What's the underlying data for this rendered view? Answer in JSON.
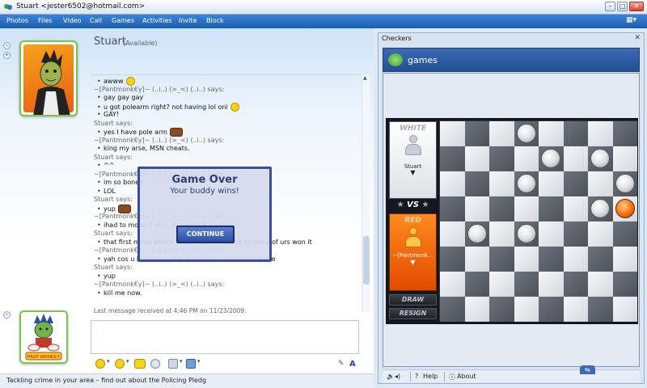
{
  "window": {
    "title": "Stuart <jester6502@hotmail.com>"
  },
  "menu": {
    "items": [
      "Photos",
      "Files",
      "Video",
      "Call",
      "Games",
      "Activities",
      "Invite",
      "Block"
    ]
  },
  "contact": {
    "name": "Stuart",
    "status": "(Available)"
  },
  "conversation": [
    {
      "type": "msg",
      "text": "awww",
      "emoticon": "smile"
    },
    {
      "type": "said",
      "text": "~[Pantmonk€y]~ (..i..) (>_<) (..i..) says:"
    },
    {
      "type": "msg",
      "text": "gay gay gay"
    },
    {
      "type": "msg",
      "text": "u got polearm right? not having lol oni",
      "emoticon": "smile"
    },
    {
      "type": "msg",
      "text": "GAY!"
    },
    {
      "type": "said",
      "text": "Stuart says:"
    },
    {
      "type": "msg",
      "text": "yes I have pole arm",
      "emoticon": "cake"
    },
    {
      "type": "said",
      "text": "~[Pantmonk€y]~ (..i..) (>_<) (..i..) says:"
    },
    {
      "type": "msg",
      "text": "king my arse, MSN cheats."
    },
    {
      "type": "said",
      "text": "Stuart says:"
    },
    {
      "type": "msg",
      "text": "^^"
    },
    {
      "type": "said",
      "text": "~[Pantmonk€y]~ (..i..) (>_<) (..i..) says:"
    },
    {
      "type": "msg",
      "text": "im so boned."
    },
    {
      "type": "msg",
      "text": "LOL"
    },
    {
      "type": "said",
      "text": "Stuart says:"
    },
    {
      "type": "msg",
      "text": "yup",
      "emoticon": "cake"
    },
    {
      "type": "said",
      "text": "~[Pantmonk€y]~ (..i..) (>_<) (..i..) says:"
    },
    {
      "type": "msg",
      "text": "ihad to move it also, its weird this game"
    },
    {
      "type": "said",
      "text": "Stuart says:"
    },
    {
      "type": "msg",
      "text": "that first move where I scraficed one piece to get 2 of urs won it"
    },
    {
      "type": "said",
      "text": "~[Pantmonk€y]~ (..i..) (>_<) (..i..) says:"
    },
    {
      "type": "msg",
      "text": "yah cos u knew it wud lock me into some lame move"
    },
    {
      "type": "said",
      "text": "Stuart says:"
    },
    {
      "type": "msg",
      "text": "yup"
    },
    {
      "type": "said",
      "text": "~[Pantmonk€y]~ (..i..) (>_<) (..i..) says:"
    },
    {
      "type": "msg",
      "text": "kill me now."
    }
  ],
  "last_received": "Last message received at 4:46 PM on 11/23/2009.",
  "input": {
    "value": "",
    "send_label": "A"
  },
  "ad_text": "Tackling crime in your area – find out about the Policing Pledg",
  "panel": {
    "title": "Checkers",
    "close": "✕",
    "games_label": "games"
  },
  "checkers": {
    "white_label": "WHITE",
    "white_player": "Stuart",
    "vs_label": "VS",
    "red_label": "RED",
    "red_player": "~[Pantmonk...",
    "draw_label": "DRAW",
    "resign_label": "RESIGN",
    "board": [
      [
        "",
        "",
        "",
        "W",
        "",
        "",
        "",
        ""
      ],
      [
        "",
        "",
        "",
        "",
        "W",
        "",
        "W",
        ""
      ],
      [
        "",
        "",
        "",
        "W",
        "",
        "",
        "",
        "W"
      ],
      [
        "",
        "",
        "",
        "",
        "",
        "",
        "W",
        "R"
      ],
      [
        "",
        "W",
        "",
        "W",
        "",
        "",
        "",
        ""
      ],
      [
        "",
        "",
        "",
        "",
        "",
        "",
        "",
        ""
      ],
      [
        "",
        "",
        "",
        "",
        "",
        "",
        "",
        ""
      ],
      [
        "",
        "",
        "",
        "",
        "",
        "",
        "",
        ""
      ]
    ],
    "game_over_title": "Game Over",
    "game_over_subtitle": "Your buddy wins!",
    "continue_label": "CONTINUE"
  },
  "footer": {
    "help": "Help",
    "about": "About"
  },
  "colors": {
    "menubar": "#2a6cc2",
    "avatar_border": "#7bc54a",
    "game_header": "#2f5ba3",
    "red_panel": "#f2640f"
  }
}
